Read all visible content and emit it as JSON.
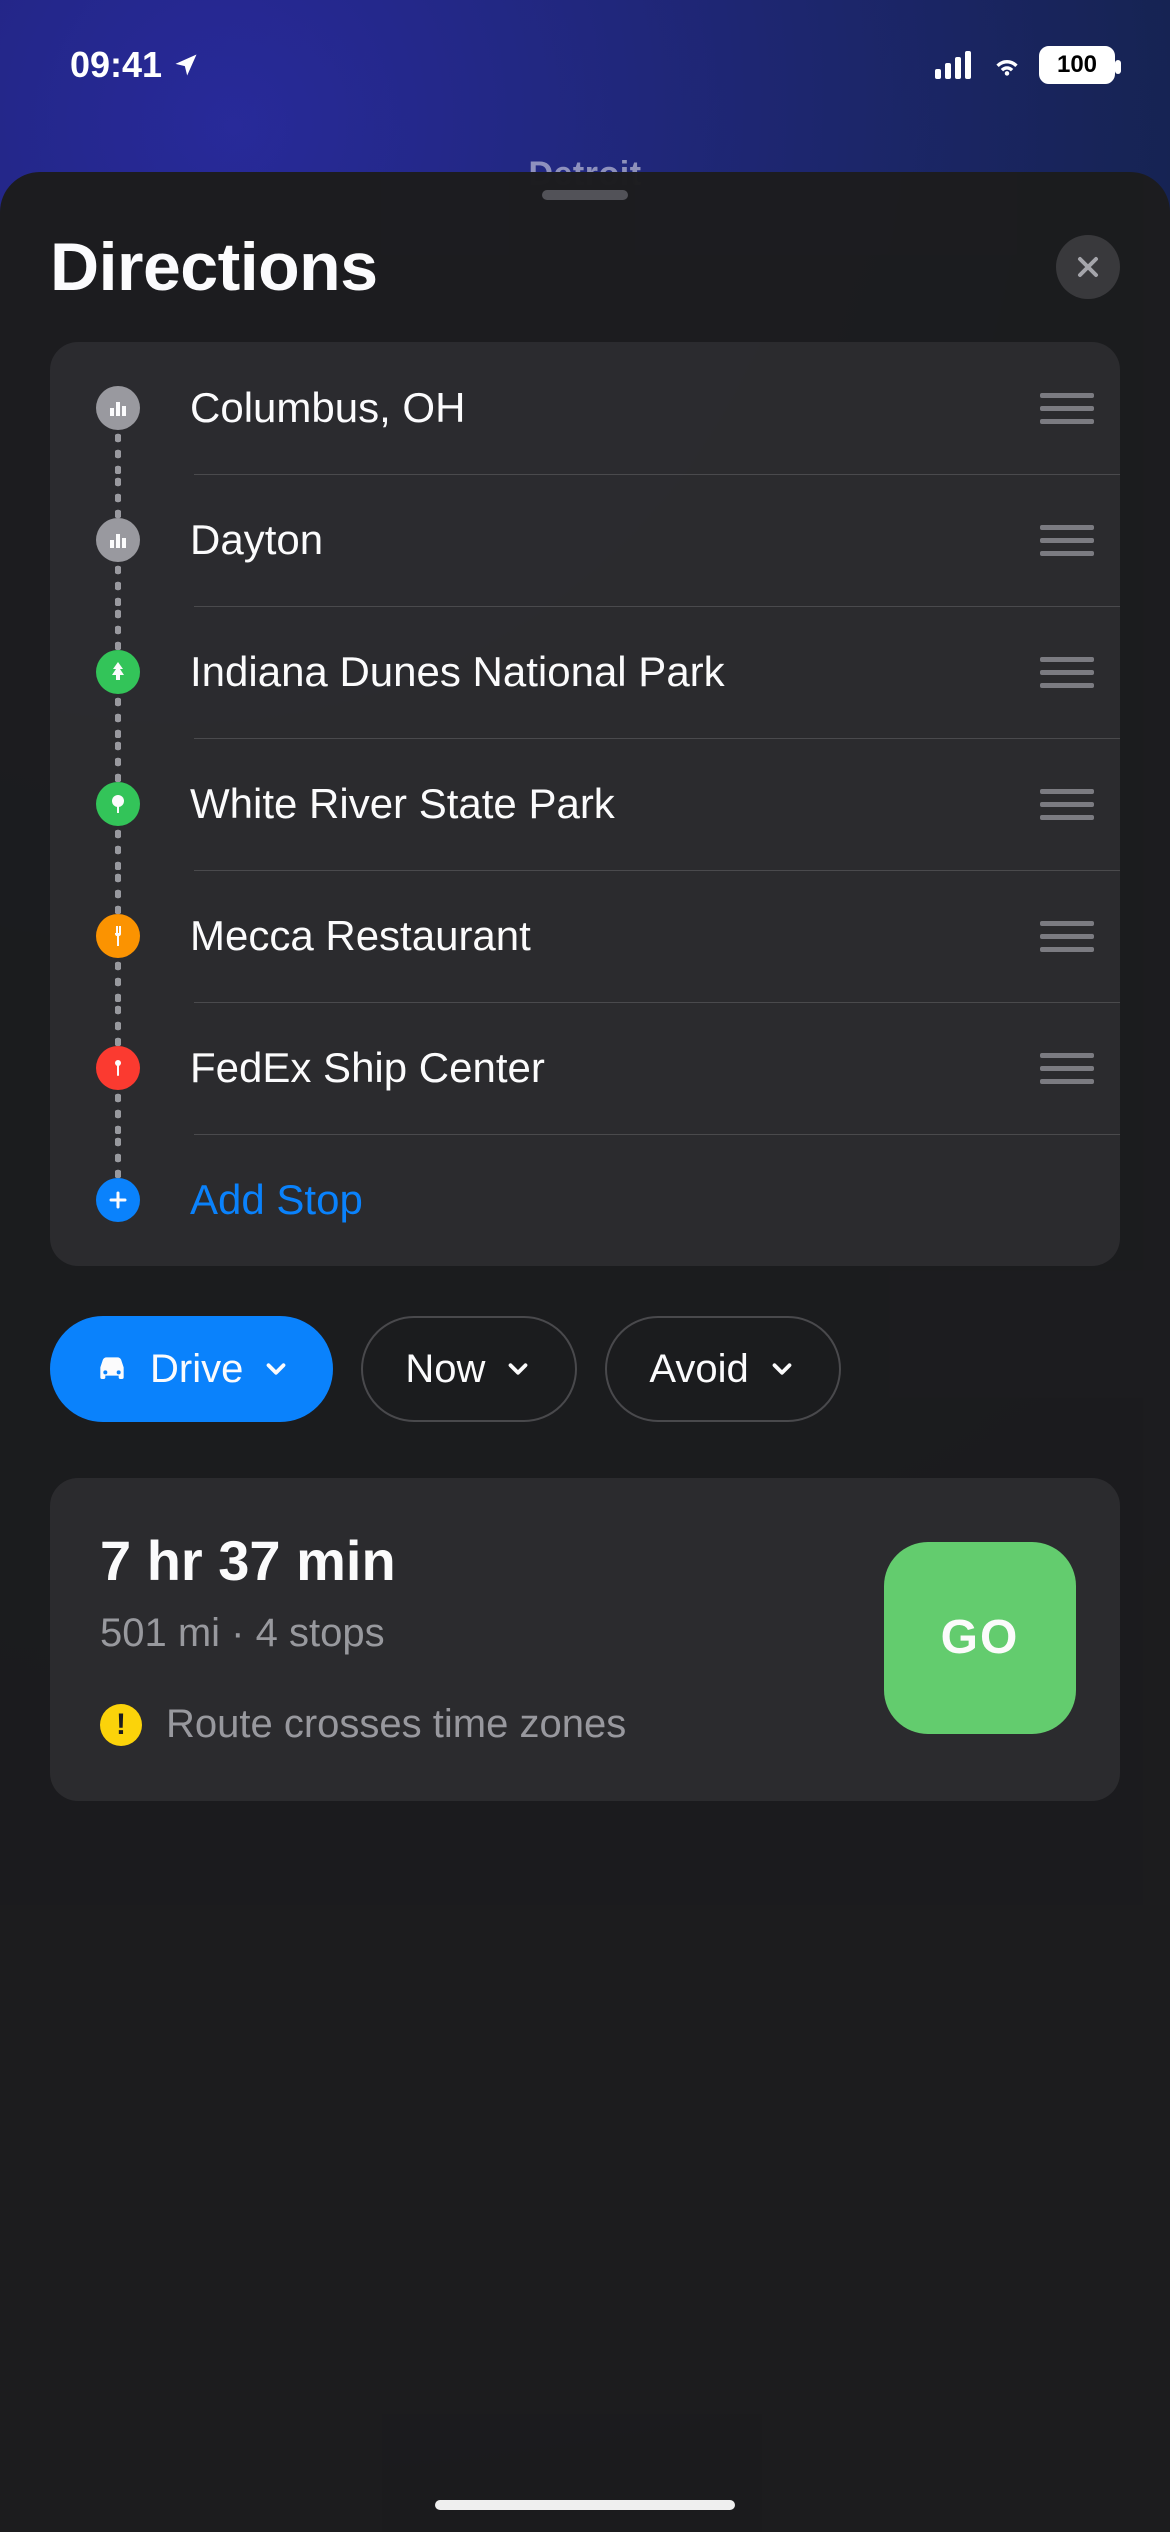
{
  "status_bar": {
    "time": "09:41",
    "battery": "100"
  },
  "map": {
    "peek_label": "Detroit"
  },
  "header": {
    "title": "Directions"
  },
  "stops": [
    {
      "label": "Columbus, OH",
      "icon": "city",
      "color": "#9b9ba0"
    },
    {
      "label": "Dayton",
      "icon": "city",
      "color": "#9b9ba0"
    },
    {
      "label": "Indiana Dunes National Park",
      "icon": "tree",
      "color": "#34c759"
    },
    {
      "label": "White River State Park",
      "icon": "tree2",
      "color": "#34c759"
    },
    {
      "label": "Mecca Restaurant",
      "icon": "food",
      "color": "#ff9500"
    },
    {
      "label": "FedEx Ship Center",
      "icon": "pin",
      "color": "#ff3b30"
    }
  ],
  "add_stop_label": "Add Stop",
  "chips": {
    "mode": "Drive",
    "depart": "Now",
    "avoid": "Avoid"
  },
  "route": {
    "eta": "7 hr 37 min",
    "distance": "501 mi",
    "stops_summary": "4 stops",
    "warning": "Route crosses time zones",
    "go_label": "GO"
  }
}
